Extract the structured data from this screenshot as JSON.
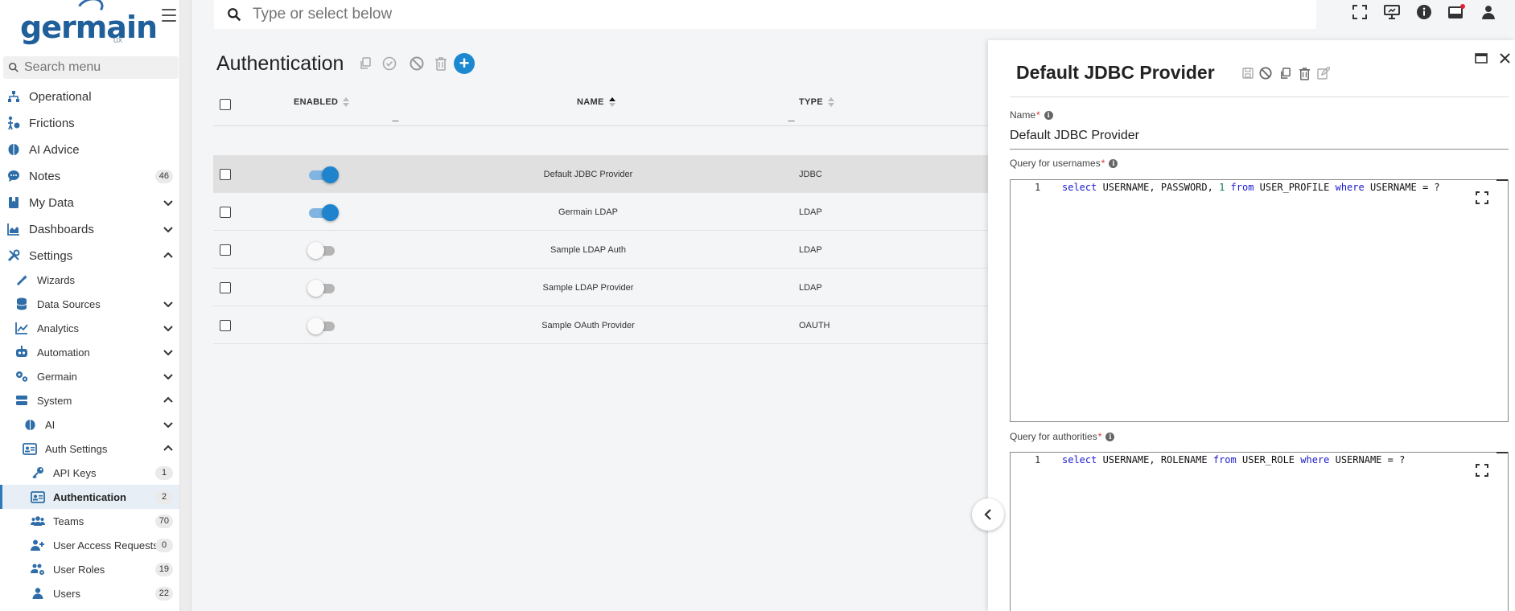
{
  "brand": {
    "logo_text": "germain",
    "logo_sub": "UX"
  },
  "sidebar": {
    "search_placeholder": "Search menu",
    "items": [
      {
        "label": "Operational",
        "icon": "sitemap-icon"
      },
      {
        "label": "Frictions",
        "icon": "friction-icon"
      },
      {
        "label": "AI Advice",
        "icon": "brain-icon"
      },
      {
        "label": "Notes",
        "icon": "chat-icon",
        "badge": "46"
      },
      {
        "label": "My Data",
        "icon": "bookmark-icon"
      },
      {
        "label": "Dashboards",
        "icon": "area-chart-icon"
      },
      {
        "label": "Settings",
        "icon": "tools-icon"
      },
      {
        "label": "Wizards",
        "icon": "wand-icon"
      },
      {
        "label": "Data Sources",
        "icon": "database-icon"
      },
      {
        "label": "Analytics",
        "icon": "line-chart-icon"
      },
      {
        "label": "Automation",
        "icon": "robot-icon"
      },
      {
        "label": "Germain",
        "icon": "gears-icon"
      },
      {
        "label": "System",
        "icon": "server-icon"
      },
      {
        "label": "AI",
        "icon": "brain-icon"
      },
      {
        "label": "Auth Settings",
        "icon": "id-card-icon"
      },
      {
        "label": "API Keys",
        "icon": "key-icon",
        "badge": "1"
      },
      {
        "label": "Authentication",
        "icon": "id-card-icon",
        "badge": "2"
      },
      {
        "label": "Teams",
        "icon": "users-icon",
        "badge": "70"
      },
      {
        "label": "User Access Requests",
        "icon": "user-plus-icon",
        "badge": "0"
      },
      {
        "label": "User Roles",
        "icon": "users-cog-icon",
        "badge": "19"
      },
      {
        "label": "Users",
        "icon": "user-icon",
        "badge": "22"
      }
    ]
  },
  "topbar": {
    "search_placeholder": "Type or select below"
  },
  "main": {
    "title": "Authentication",
    "columns": {
      "enabled": "ENABLED",
      "name": "NAME",
      "type": "TYPE"
    },
    "rows": [
      {
        "enabled": true,
        "name": "Default JDBC Provider",
        "type": "JDBC"
      },
      {
        "enabled": true,
        "name": "Germain LDAP",
        "type": "LDAP"
      },
      {
        "enabled": false,
        "name": "Sample LDAP Auth",
        "type": "LDAP"
      },
      {
        "enabled": false,
        "name": "Sample LDAP Provider",
        "type": "LDAP"
      },
      {
        "enabled": false,
        "name": "Sample OAuth Provider",
        "type": "OAUTH"
      }
    ]
  },
  "panel": {
    "title": "Default JDBC Provider",
    "name_label": "Name",
    "name_value": "Default JDBC Provider",
    "usernames_label": "Query for usernames",
    "authorities_label": "Query for authorities",
    "line_number": "1",
    "usernames_query": {
      "t1": "select",
      "t2": " USERNAME, PASSWORD, ",
      "t3": "1",
      "t4": " ",
      "t5": "from",
      "t6": " USER_PROFILE ",
      "t7": "where",
      "t8": " USERNAME = ?"
    },
    "authorities_query": {
      "t1": "select",
      "t2": " USERNAME, ROLENAME ",
      "t3": "from",
      "t4": " USER_ROLE ",
      "t5": "where",
      "t6": " USERNAME = ?"
    }
  },
  "colors": {
    "accent": "#1f84cd",
    "brand": "#1f5f9a",
    "selected_row": "#e0e0e0"
  }
}
